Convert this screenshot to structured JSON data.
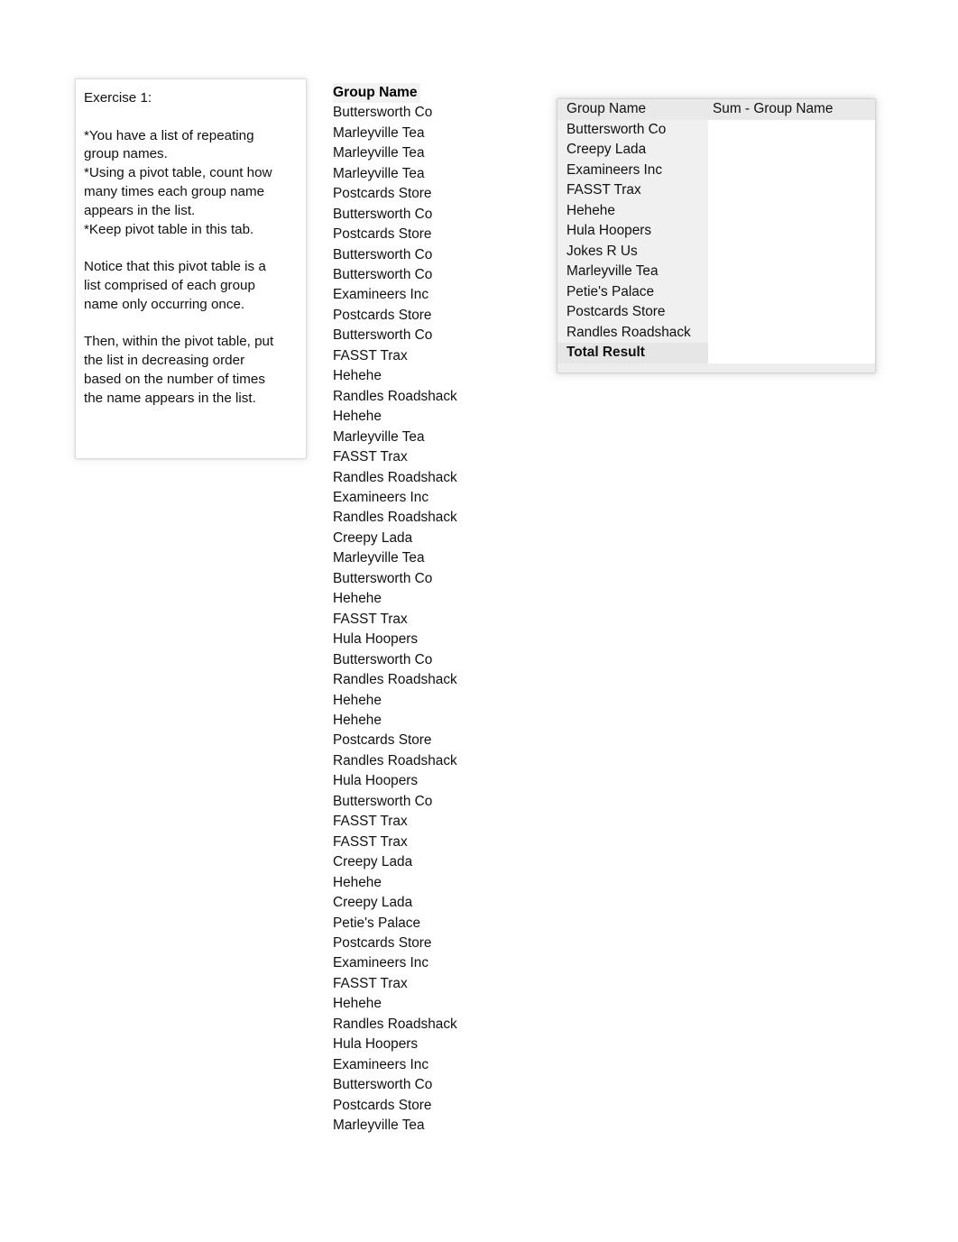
{
  "exercise": {
    "title": "Exercise 1:",
    "paragraphs": [
      "*You have a list of repeating\ngroup names.\n*Using a pivot table, count how\nmany times each group name\nappears in the list.\n*Keep pivot table in this tab.",
      "Notice that this pivot table is a\nlist comprised of each group\nname only occurring once.",
      "Then, within the pivot table, put\nthe list in decreasing order\nbased on the number of times\nthe name appears in the list."
    ]
  },
  "data_column": {
    "header": "Group Name",
    "values": [
      "Buttersworth Co",
      "Marleyville Tea",
      "Marleyville Tea",
      "Marleyville Tea",
      "Postcards Store",
      "Buttersworth Co",
      "Postcards Store",
      "Buttersworth Co",
      "Buttersworth Co",
      "Examineers Inc",
      "Postcards Store",
      "Buttersworth Co",
      "FASST Trax",
      "Hehehe",
      "Randles Roadshack",
      "Hehehe",
      "Marleyville Tea",
      "FASST Trax",
      "Randles Roadshack",
      "Examineers Inc",
      "Randles Roadshack",
      "Creepy Lada",
      "Marleyville Tea",
      "Buttersworth Co",
      "Hehehe",
      "FASST Trax",
      "Hula Hoopers",
      "Buttersworth Co",
      "Randles Roadshack",
      "Hehehe",
      "Hehehe",
      "Postcards Store",
      "Randles Roadshack",
      "Hula Hoopers",
      "Buttersworth Co",
      "FASST Trax",
      "FASST Trax",
      "Creepy Lada",
      "Hehehe",
      "Creepy Lada",
      "Petie's Palace",
      "Postcards Store",
      "Examineers Inc",
      "FASST Trax",
      "Hehehe",
      "Randles Roadshack",
      "Hula Hoopers",
      "Examineers Inc",
      "Buttersworth Co",
      "Postcards Store",
      "Marleyville Tea"
    ]
  },
  "pivot_table": {
    "headers": [
      "Group Name",
      "Sum - Group Name"
    ],
    "rows": [
      {
        "group_name": "Buttersworth Co",
        "sum": ""
      },
      {
        "group_name": "Creepy Lada",
        "sum": ""
      },
      {
        "group_name": "Examineers Inc",
        "sum": ""
      },
      {
        "group_name": "FASST Trax",
        "sum": ""
      },
      {
        "group_name": "Hehehe",
        "sum": ""
      },
      {
        "group_name": "Hula Hoopers",
        "sum": ""
      },
      {
        "group_name": "Jokes R Us",
        "sum": ""
      },
      {
        "group_name": "Marleyville Tea",
        "sum": ""
      },
      {
        "group_name": "Petie's Palace",
        "sum": ""
      },
      {
        "group_name": "Postcards Store",
        "sum": ""
      },
      {
        "group_name": "Randles Roadshack",
        "sum": ""
      }
    ],
    "total_label": "Total Result",
    "total_value": ""
  },
  "colors": {
    "page_background": "#ffffff",
    "text": "#111111",
    "header_shade": "#e9e9e9",
    "row_shade": "#f0f0f0",
    "total_shade": "#e6e6e6"
  }
}
